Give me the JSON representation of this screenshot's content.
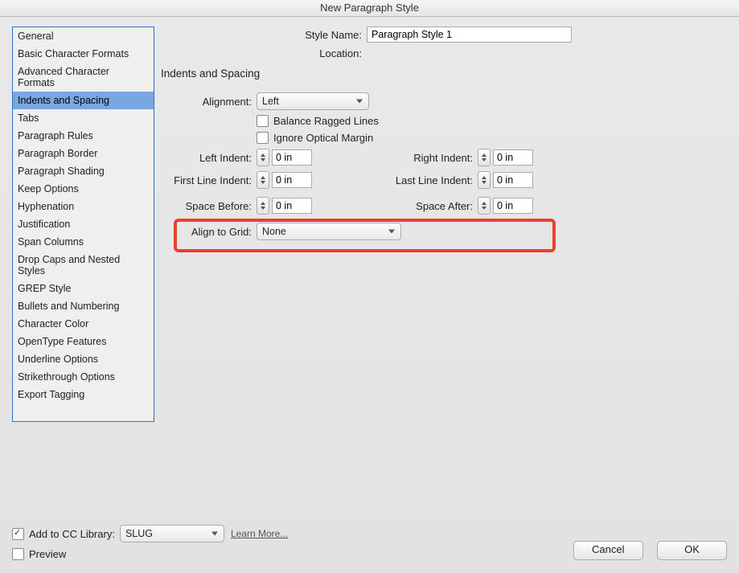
{
  "window": {
    "title": "New Paragraph Style"
  },
  "sidebar": {
    "items": [
      {
        "label": "General"
      },
      {
        "label": "Basic Character Formats"
      },
      {
        "label": "Advanced Character Formats"
      },
      {
        "label": "Indents and Spacing",
        "selected": true
      },
      {
        "label": "Tabs"
      },
      {
        "label": "Paragraph Rules"
      },
      {
        "label": "Paragraph Border"
      },
      {
        "label": "Paragraph Shading"
      },
      {
        "label": "Keep Options"
      },
      {
        "label": "Hyphenation"
      },
      {
        "label": "Justification"
      },
      {
        "label": "Span Columns"
      },
      {
        "label": "Drop Caps and Nested Styles"
      },
      {
        "label": "GREP Style"
      },
      {
        "label": "Bullets and Numbering"
      },
      {
        "label": "Character Color"
      },
      {
        "label": "OpenType Features"
      },
      {
        "label": "Underline Options"
      },
      {
        "label": "Strikethrough Options"
      },
      {
        "label": "Export Tagging"
      }
    ]
  },
  "header": {
    "style_name_label": "Style Name:",
    "style_name_value": "Paragraph Style 1",
    "location_label": "Location:"
  },
  "panel": {
    "title": "Indents and Spacing",
    "alignment_label": "Alignment:",
    "alignment_value": "Left",
    "balance_label": "Balance Ragged Lines",
    "ignore_label": "Ignore Optical Margin",
    "left_indent_label": "Left Indent:",
    "left_indent_value": "0 in",
    "right_indent_label": "Right Indent:",
    "right_indent_value": "0 in",
    "first_line_label": "First Line Indent:",
    "first_line_value": "0 in",
    "last_line_label": "Last Line Indent:",
    "last_line_value": "0 in",
    "space_before_label": "Space Before:",
    "space_before_value": "0 in",
    "space_after_label": "Space After:",
    "space_after_value": "0 in",
    "align_grid_label": "Align to Grid:",
    "align_grid_value": "None"
  },
  "footer": {
    "add_library_label": "Add to CC Library:",
    "add_library_checked": true,
    "library_value": "SLUG",
    "learn_more": "Learn More...",
    "preview_label": "Preview",
    "cancel": "Cancel",
    "ok": "OK"
  }
}
